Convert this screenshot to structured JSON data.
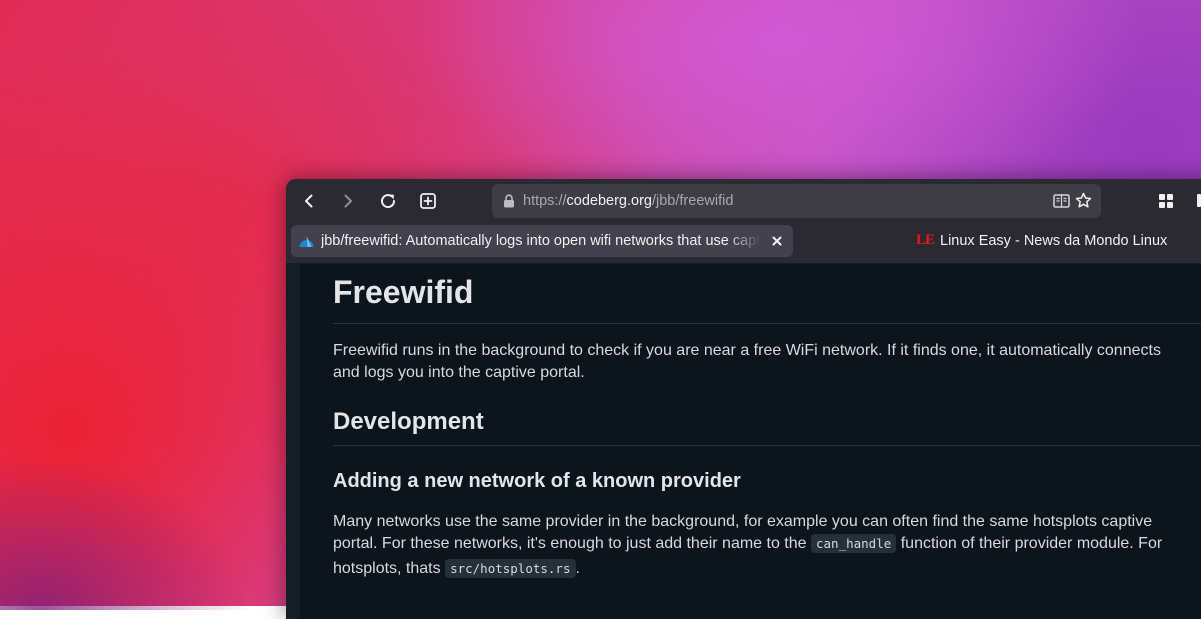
{
  "toolbar": {
    "back_icon": "arrow-left-icon",
    "forward_icon": "arrow-right-icon",
    "reload_icon": "reload-icon",
    "new_tab_icon": "plus-square-icon",
    "url": {
      "prefix": "https://",
      "host": "codeberg.org",
      "path": "/jbb/freewifid"
    },
    "lock_icon": "lock-icon",
    "reader_icon": "reader-view-icon",
    "bookmark_icon": "star-icon",
    "extensions_icon": "grid-icon"
  },
  "tabs": [
    {
      "title": "jbb/freewifid: Automatically logs into open wifi networks that use captive portals",
      "active": true,
      "favicon": "codeberg-icon"
    },
    {
      "title": "Linux Easy - News da Mondo Linux",
      "active": false,
      "favicon": "LE"
    }
  ],
  "page": {
    "h1": "Freewifid",
    "intro": {
      "line1": "Freewifid runs in the background to check if you are near a free WiFi network. If it finds one, it automatically connects",
      "line2": "and logs you into the captive portal."
    },
    "h2": "Development",
    "h3": "Adding a new network of a known provider",
    "para": {
      "line1": "Many networks use the same provider in the background, for example you can often find the same hotsplots captive",
      "line2_a": "portal. For these networks, it's enough to just add their name to the",
      "code1": "can_handle",
      "line2_b": "function of their provider module. For",
      "line3_a": "hotsplots, thats",
      "code2": "src/hotsplots.rs",
      "line3_b": "."
    }
  },
  "colors": {
    "toolbar_bg": "#2b2a33",
    "urlbar_bg": "#3e3d45",
    "active_tab_bg": "#42414d",
    "page_bg": "#0d151c",
    "le_red": "#e8161b",
    "codeberg_blue": "#2185d0"
  }
}
